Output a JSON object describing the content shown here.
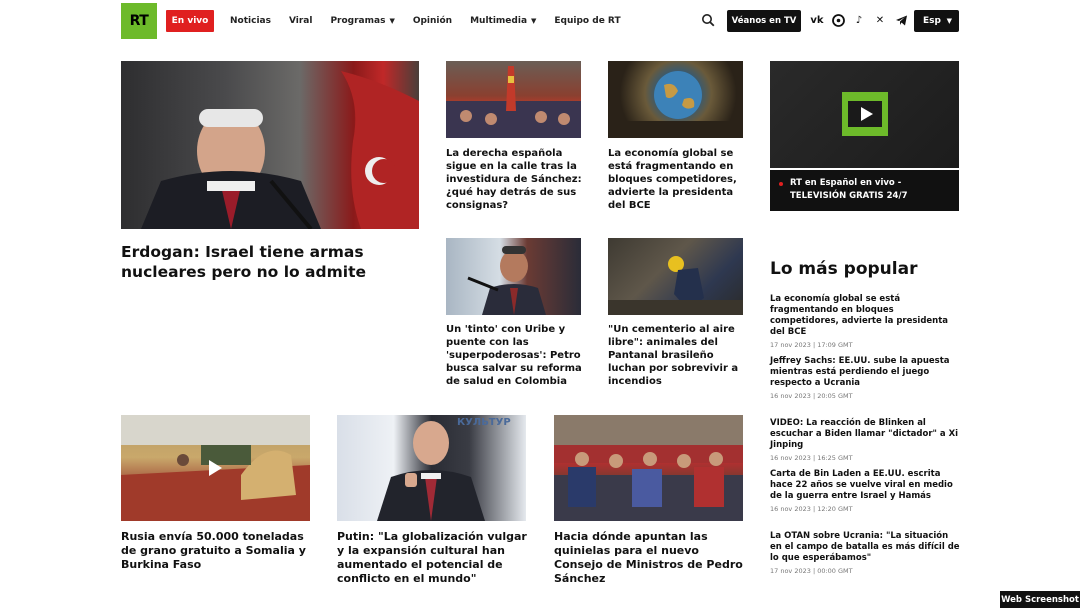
{
  "header": {
    "logo": "RT",
    "live_label": "En vivo",
    "nav": [
      {
        "label": "Noticias",
        "dropdown": false
      },
      {
        "label": "Viral",
        "dropdown": false
      },
      {
        "label": "Programas",
        "dropdown": true
      },
      {
        "label": "Opinión",
        "dropdown": false
      },
      {
        "label": "Multimedia",
        "dropdown": true
      },
      {
        "label": "Equipo de RT",
        "dropdown": false
      }
    ],
    "watch_label": "Véanos en TV",
    "socials": [
      "vk-icon",
      "odnoklassniki-icon",
      "tiktok-icon",
      "x-icon",
      "telegram-icon"
    ],
    "lang_label": "Esp"
  },
  "hero": {
    "title": "Erdogan: Israel tiene armas nucleares pero no lo admite"
  },
  "tiles": [
    {
      "title": "La derecha española sigue en la calle tras la investidura de Sánchez: ¿qué hay detrás de sus consignas?"
    },
    {
      "title": "La economía global se está fragmentando en bloques competidores, advierte la presidenta del BCE"
    },
    {
      "title": "Un 'tinto' con Uribe y puente con las 'superpoderosas': Petro busca salvar su reforma de salud en Colombia"
    },
    {
      "title": "\"Un cementerio al aire libre\": animales del Pantanal brasileño luchan por sobrevivir a incendios"
    }
  ],
  "bottom": [
    {
      "title": "Rusia envía 50.000 toneladas de grano gratuito a Somalia y Burkina Faso"
    },
    {
      "title": "Putin: \"La globalización vulgar y la expansión cultural han aumentado el potencial de conflicto en el mundo\"",
      "image_sign": "КУЛЬТУР"
    },
    {
      "title": "Hacia dónde apuntan las quinielas para el nuevo Consejo de Ministros de Pedro Sánchez"
    }
  ],
  "tv": {
    "caption": "RT en Español en vivo - TELEVISIÓN GRATIS 24/7"
  },
  "popular": {
    "title": "Lo más popular",
    "items": [
      {
        "text": "La economía global se está fragmentando en bloques competidores, advierte la presidenta del BCE",
        "date": "17 nov 2023 | 17:09 GMT"
      },
      {
        "text": "Jeffrey Sachs: EE.UU. sube la apuesta mientras está perdiendo el juego respecto a Ucrania",
        "date": "16 nov 2023 | 20:05 GMT"
      },
      {
        "text": "VIDEO: La reacción de Blinken al escuchar a Biden llamar \"dictador\" a Xi Jinping",
        "date": "16 nov 2023 | 16:25 GMT"
      },
      {
        "text": "Carta de Bin Laden a EE.UU. escrita hace 22 años se vuelve viral en medio de la guerra entre Israel y Hamás",
        "date": "16 nov 2023 | 12:20 GMT"
      },
      {
        "text": "La OTAN sobre Ucrania: \"La situación en el campo de batalla es más difícil de lo que esperábamos\"",
        "date": "17 nov 2023 | 00:00 GMT"
      }
    ]
  },
  "badge": "Web Screenshot"
}
